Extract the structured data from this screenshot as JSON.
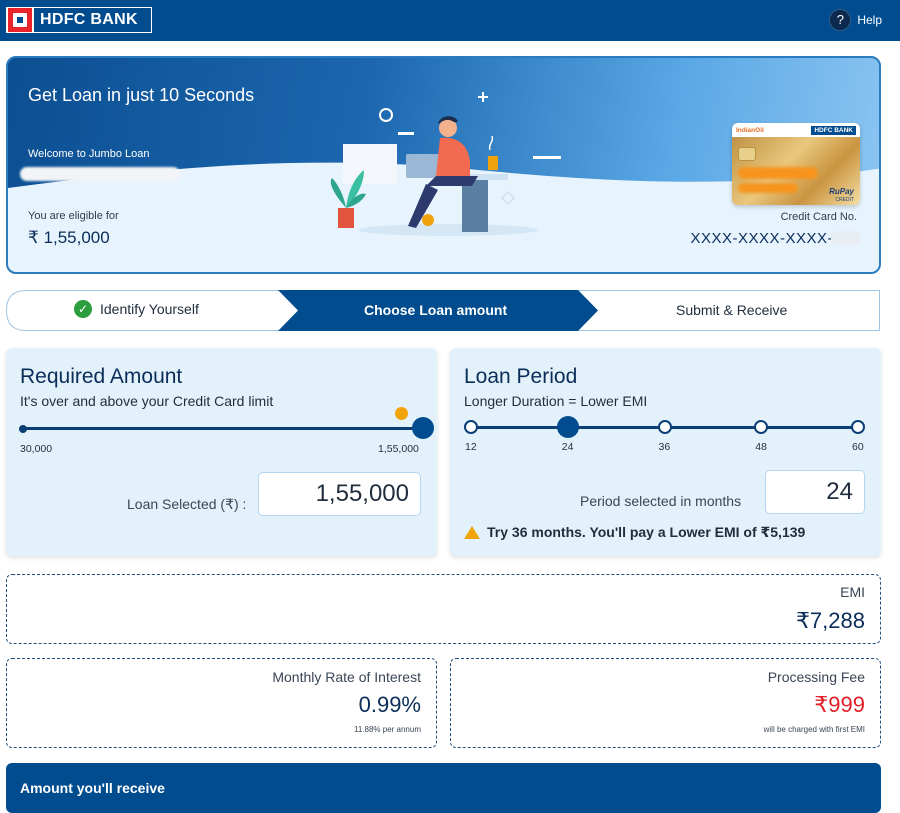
{
  "header": {
    "bank_name": "HDFC BANK",
    "help_label": "Help"
  },
  "hero": {
    "title": "Get Loan in just 10 Seconds",
    "welcome": "Welcome to Jumbo Loan",
    "eligible_label": "You are eligible for",
    "eligible_amount": "₹ 1,55,000",
    "card_no_label": "Credit Card No.",
    "card_no_value": "XXXX-XXXX-XXXX-",
    "card_brand_left": "IndianOil",
    "card_brand_right": "HDFC BANK",
    "card_network": "RuPay",
    "card_type": "CREDIT"
  },
  "steps": [
    {
      "label": "Identify Yourself",
      "status": "done"
    },
    {
      "label": "Choose Loan amount",
      "status": "active"
    },
    {
      "label": "Submit & Receive",
      "status": "pending"
    }
  ],
  "required_amount": {
    "title": "Required Amount",
    "subtitle": "It's over and above your Credit Card limit",
    "min_label": "30,000",
    "max_label": "1,55,000",
    "slider_fraction": 1.0,
    "field_label": "Loan Selected (₹) :",
    "field_value": "1,55,000"
  },
  "loan_period": {
    "title": "Loan Period",
    "subtitle": "Longer Duration = Lower EMI",
    "ticks": [
      "12",
      "24",
      "36",
      "48",
      "60"
    ],
    "selected_index": 1,
    "field_label": "Period selected in months",
    "field_value": "24",
    "tip": "Try 36 months. You'll pay a Lower EMI of ₹5,139"
  },
  "emi": {
    "label": "EMI",
    "value": "₹7,288"
  },
  "interest": {
    "label": "Monthly Rate of Interest",
    "value": "0.99%",
    "note": "11.88% per annum"
  },
  "processing_fee": {
    "label": "Processing Fee",
    "value": "₹999",
    "note": "will be charged with first EMI"
  },
  "receive": {
    "label": "Amount you'll receive"
  },
  "colors": {
    "brand_blue": "#004c8f",
    "accent_red": "#e21f26",
    "warning_amber": "#f0a30a",
    "success_green": "#2e9d3e"
  }
}
